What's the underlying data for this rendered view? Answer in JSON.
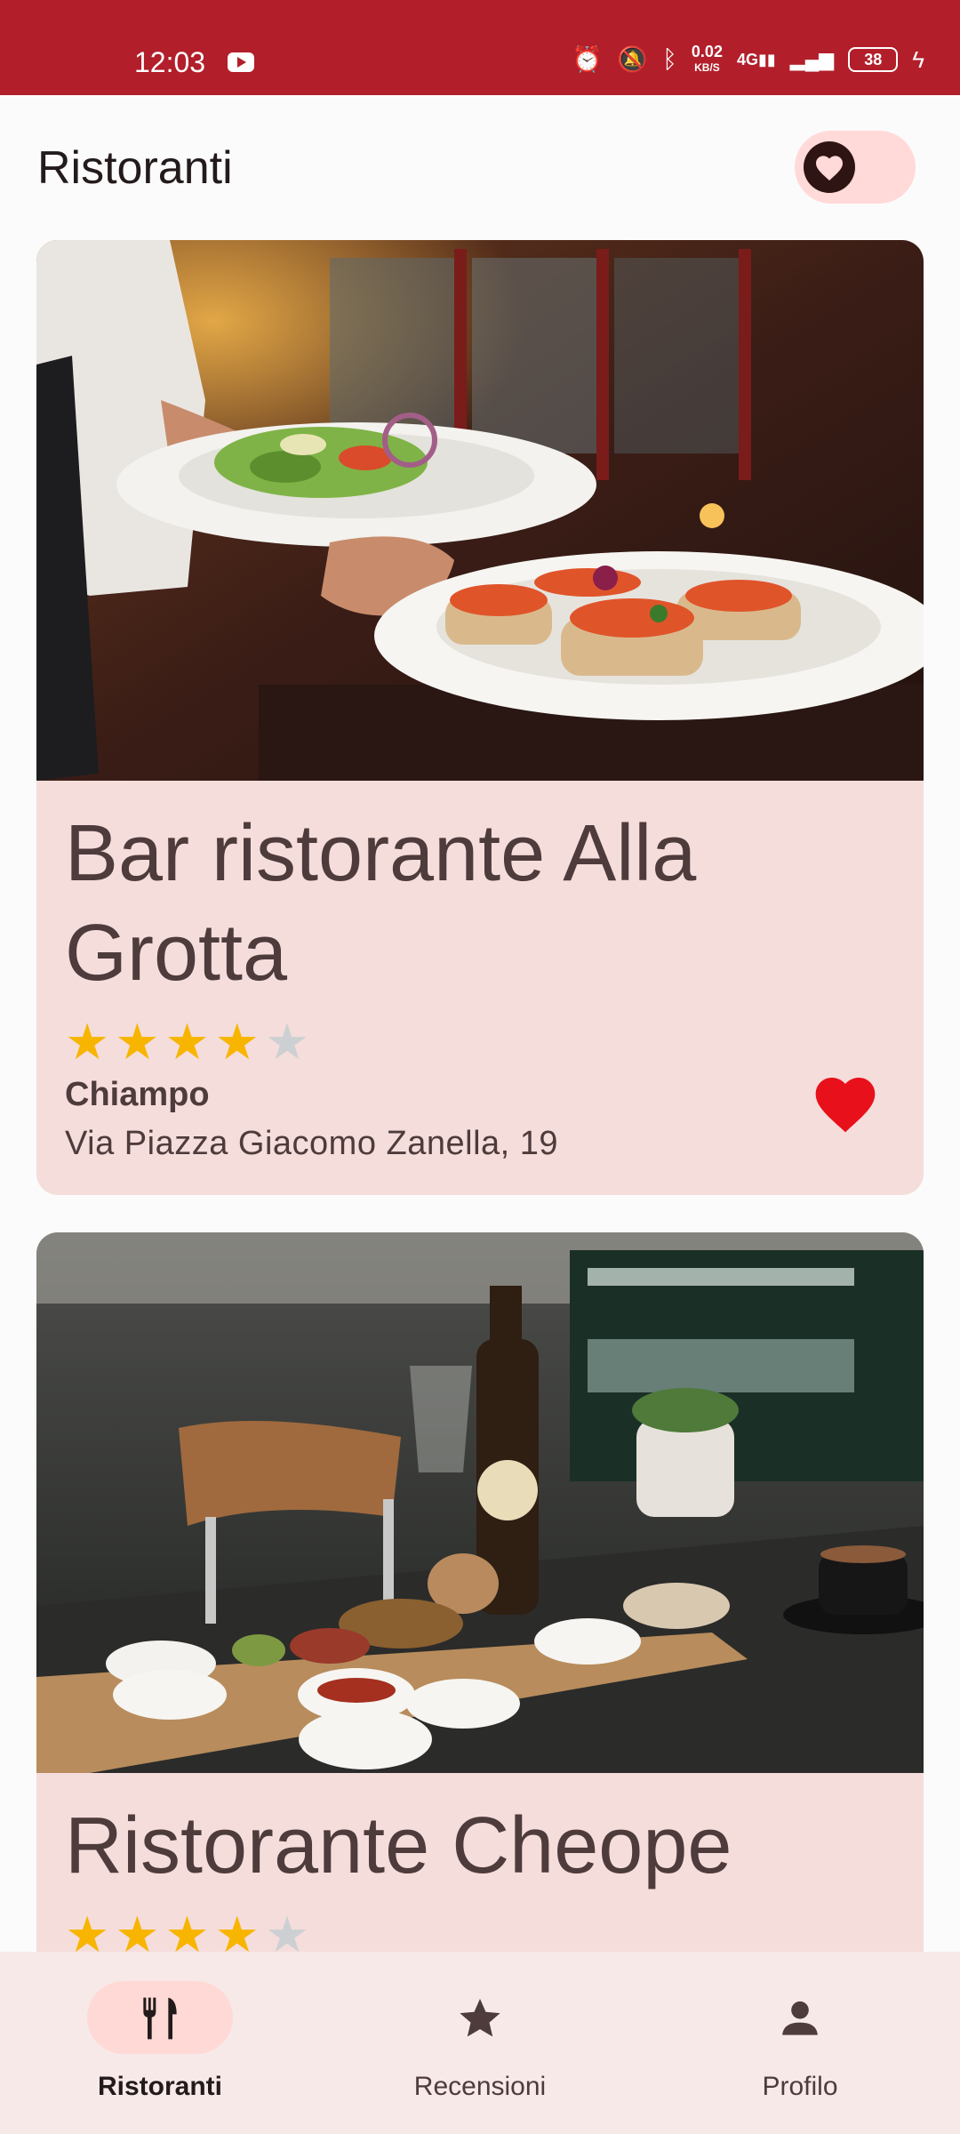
{
  "status_bar": {
    "time": "12:03",
    "net_speed": "0.02",
    "net_unit": "KB/S",
    "network_type": "4G",
    "battery": "38",
    "background_color": "#b21e2a"
  },
  "header": {
    "title": "Ristoranti",
    "favorites_filter_icon": "heart-icon"
  },
  "restaurants": [
    {
      "name": "Bar ristorante Alla Grotta",
      "rating": 4,
      "max_rating": 5,
      "city": "Chiampo",
      "address": "Via Piazza Giacomo Zanella, 19",
      "favorite": true,
      "photo": "waiter carrying salad and bruschetta plates"
    },
    {
      "name": "Ristorante Cheope",
      "rating": 4,
      "max_rating": 5,
      "photo": "charcuterie board with beer bottle and coffee"
    }
  ],
  "bottom_nav": {
    "items": [
      {
        "label": "Ristoranti",
        "icon": "fork-knife-icon",
        "active": true
      },
      {
        "label": "Recensioni",
        "icon": "star-icon",
        "active": false
      },
      {
        "label": "Profilo",
        "icon": "person-icon",
        "active": false
      }
    ]
  },
  "colors": {
    "accent": "#b21e2a",
    "card_background": "#f5dddc",
    "star_on": "#f7b500",
    "star_off": "#cdd0d2",
    "favorite_heart": "#e8101a"
  }
}
